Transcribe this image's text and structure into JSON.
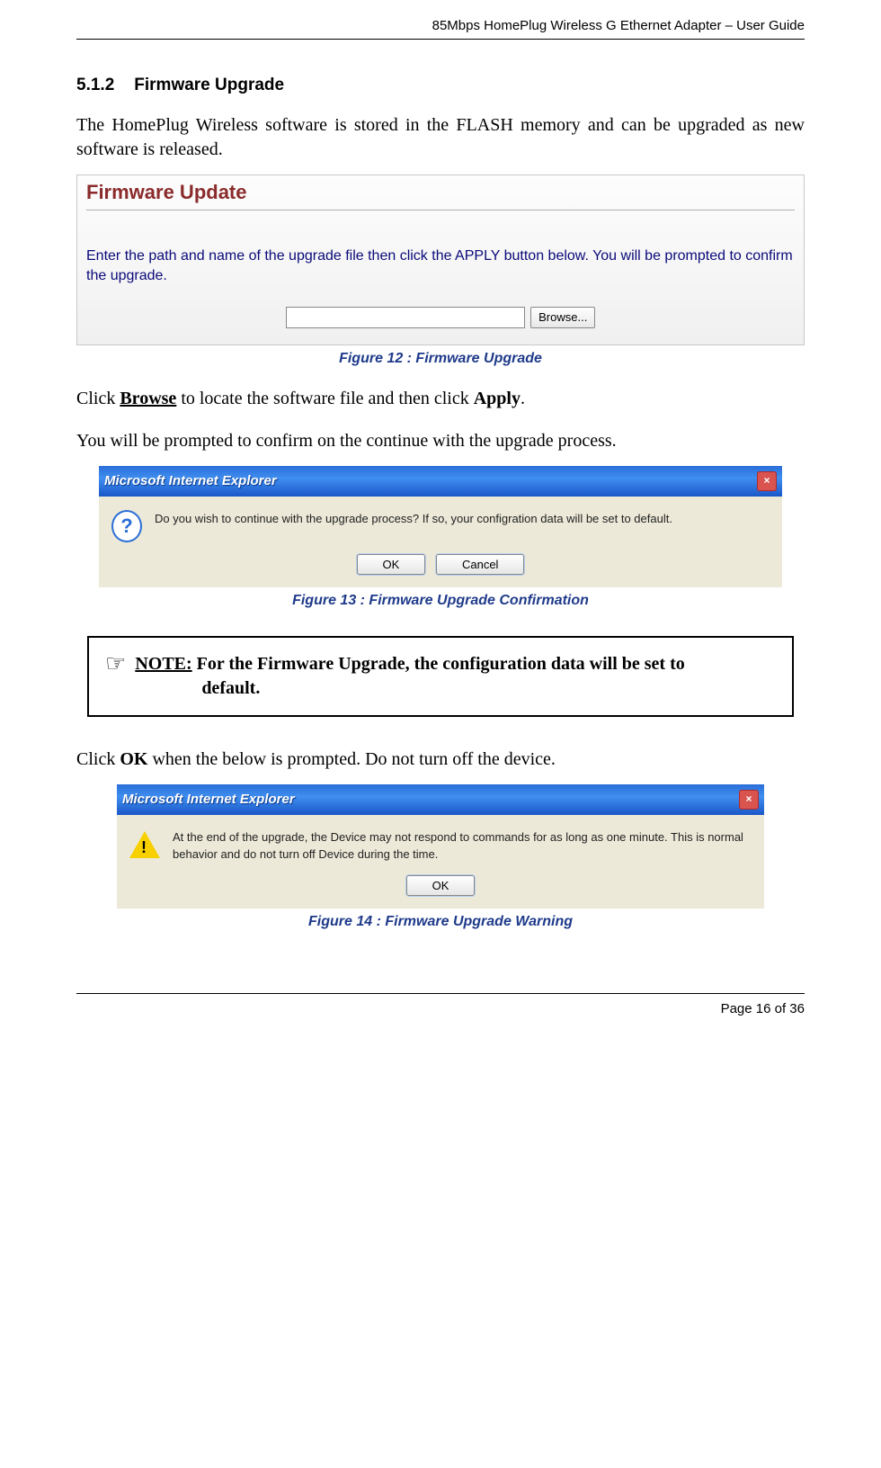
{
  "header": {
    "title": "85Mbps HomePlug Wireless G Ethernet Adapter – User Guide"
  },
  "section": {
    "number": "5.1.2",
    "title": "Firmware Upgrade"
  },
  "paragraphs": {
    "intro": "The HomePlug Wireless software is stored in the FLASH memory and can be upgraded as new software is released.",
    "click_browse_prefix": "Click ",
    "click_browse_bold": "Browse",
    "click_browse_mid": " to locate the software file and then click ",
    "click_browse_bold2": "Apply",
    "click_browse_suffix": ".",
    "prompt_confirm": "You will be prompted to confirm on the continue with the upgrade process.",
    "click_ok_prefix": "Click ",
    "click_ok_bold": "OK",
    "click_ok_suffix": " when the below is prompted. Do not turn off the device."
  },
  "firmware_panel": {
    "title": "Firmware Update",
    "description": "Enter the path and name of the upgrade file then click the APPLY button below. You will be prompted to confirm the upgrade.",
    "browse_label": "Browse..."
  },
  "captions": {
    "fig12": "Figure 12 : Firmware Upgrade",
    "fig13": "Figure 13 : Firmware Upgrade Confirmation",
    "fig14": "Figure 14 : Firmware Upgrade Warning"
  },
  "dialog1": {
    "title": "Microsoft Internet Explorer",
    "message": "Do you wish to continue with the upgrade process? If so, your configration data will be set to default.",
    "ok": "OK",
    "cancel": "Cancel",
    "close": "×"
  },
  "dialog2": {
    "title": "Microsoft Internet Explorer",
    "message": "At the end of the upgrade, the Device may not respond to commands for as long as one minute. This is normal behavior and do not turn off Device during the time.",
    "ok": "OK",
    "close": "×"
  },
  "note": {
    "hand": "☞",
    "label": "NOTE:",
    "text_line1": " For the Firmware Upgrade, the configuration data will be set to",
    "text_line2": "default."
  },
  "footer": {
    "page": "Page 16 of 36"
  }
}
